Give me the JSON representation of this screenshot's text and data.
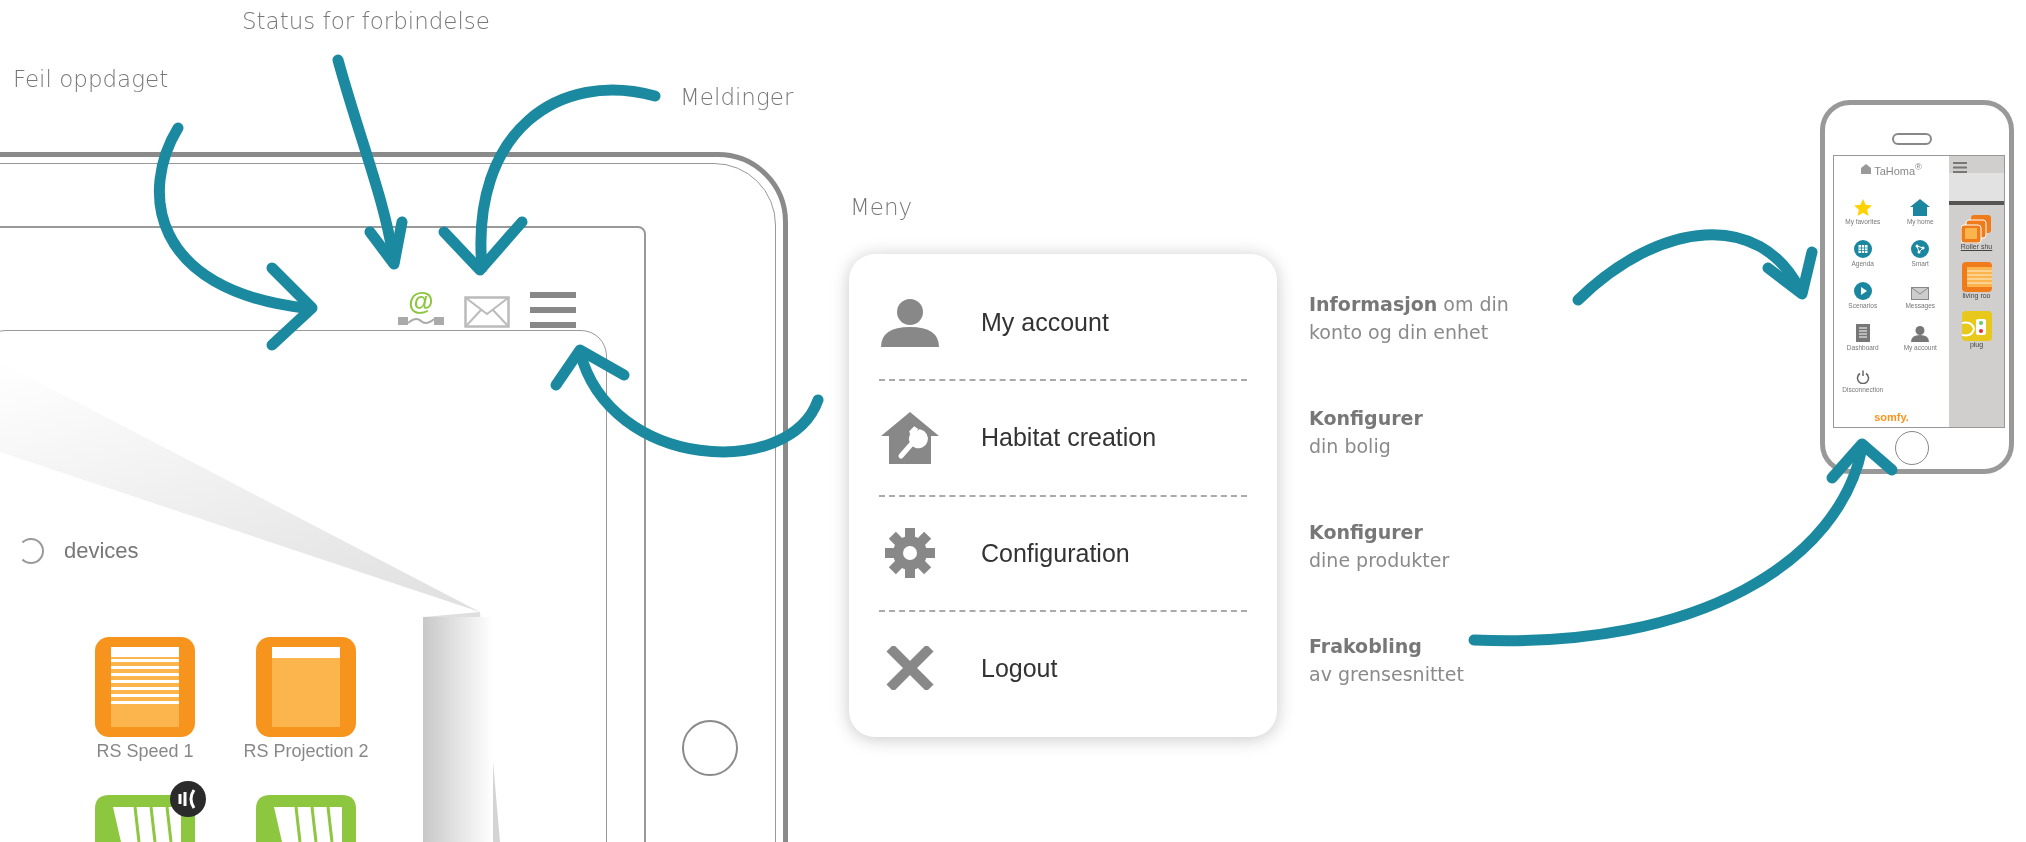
{
  "callouts": [
    {
      "text": "Feil oppdaget"
    },
    {
      "text": "Status for forbindelse"
    },
    {
      "text": "Meldinger"
    },
    {
      "text": "Meny"
    }
  ],
  "tablet": {
    "connection_symbol": "@",
    "section_label": "devices",
    "devices": [
      {
        "kind": "slats",
        "name": "RS Speed 1",
        "badge": false
      },
      {
        "kind": "screen",
        "name": "RS Projection 2",
        "badge": false
      },
      {
        "kind": "pergola",
        "badge": true
      },
      {
        "kind": "pergola",
        "badge": false
      }
    ]
  },
  "menu": {
    "items": [
      {
        "kind": "account",
        "label": "My account"
      },
      {
        "kind": "habitat",
        "label": "Habitat creation"
      },
      {
        "kind": "gear",
        "label": "Configuration"
      },
      {
        "kind": "logout",
        "label": "Logout"
      }
    ]
  },
  "descriptions": [
    "**Informasjon** om din\nkonto og din enhet",
    "**Konfigurer**\ndin bolig",
    "**Konfigurer**\ndine produkter",
    "**Frakobling**\nav grensesnittet"
  ],
  "phone": {
    "title": "TaHoma$^{®}$",
    "menu": [
      {
        "kind": "star",
        "label": "My favorites"
      },
      {
        "kind": "home",
        "label": "My home"
      },
      {
        "kind": "calendar",
        "label": "Agenda"
      },
      {
        "kind": "smart",
        "label": "Smart"
      },
      {
        "kind": "play",
        "label": "Scenarios"
      },
      {
        "kind": "mail",
        "label": "Messages"
      },
      {
        "kind": "doc",
        "label": "Dashboard"
      },
      {
        "kind": "person",
        "label": "My account"
      },
      {
        "kind": "power",
        "label": "Disconnection"
      }
    ],
    "logo": "somfy.",
    "tiles": [
      {
        "kind": "roller",
        "label": "Roller shu"
      },
      {
        "kind": "blind",
        "label": "living roo"
      },
      {
        "kind": "plug",
        "label": "plug"
      }
    ]
  }
}
